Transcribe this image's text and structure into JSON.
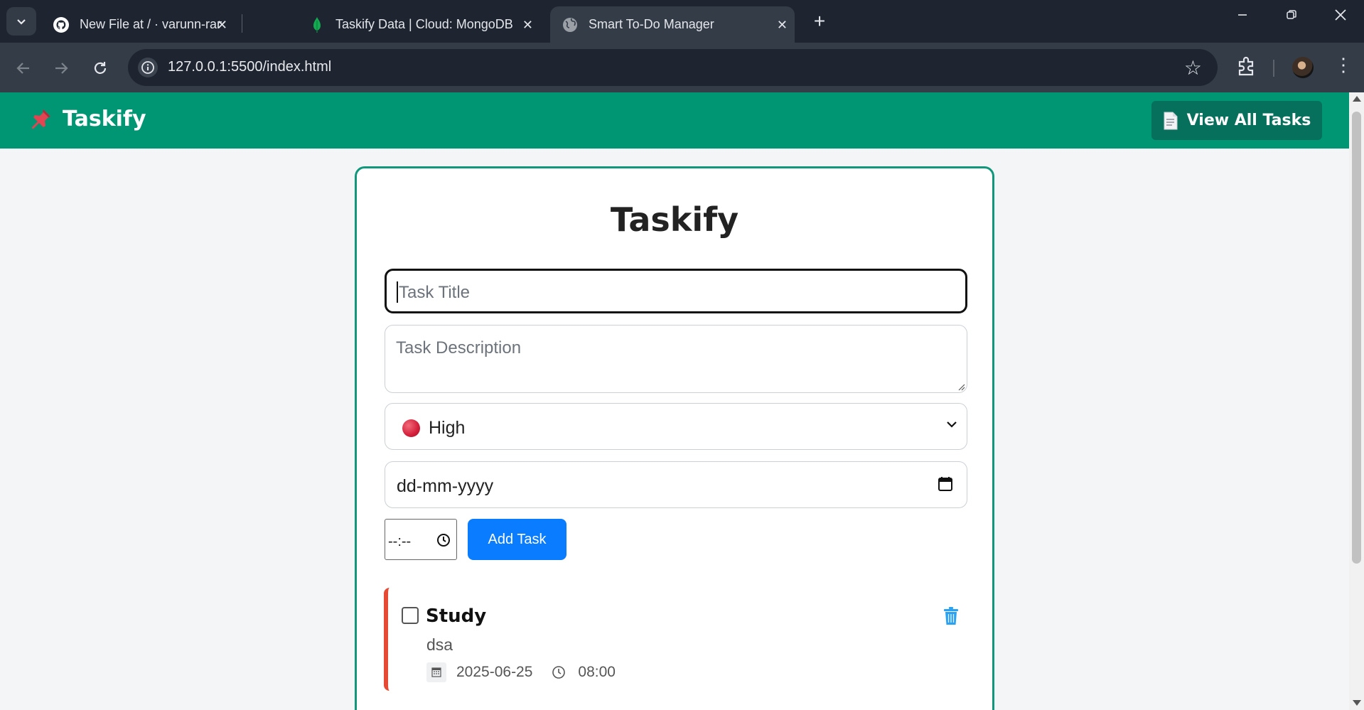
{
  "browser": {
    "tabs": [
      {
        "title": "New File at / · varunn-ranaa/Taskify",
        "icon": "github-icon"
      },
      {
        "title": "Taskify Data | Cloud: MongoDB Cloud",
        "icon": "mongodb-leaf-icon"
      },
      {
        "title": "Smart To-Do Manager",
        "icon": "globe-icon",
        "active": true
      }
    ],
    "url": "127.0.0.1:5500/index.html"
  },
  "navbar": {
    "brand": "Taskify",
    "brand_icon": "pushpin-icon",
    "view_all_label": "View All Tasks",
    "view_all_icon": "document-icon",
    "color": "#009673"
  },
  "form": {
    "title": "Taskify",
    "title_placeholder": "Task Title",
    "description_placeholder": "Task Description",
    "priority": "High",
    "priority_color": "#d31e3a",
    "date_placeholder": "dd-mm-yyyy",
    "time_placeholder": "--:--",
    "add_button": "Add Task",
    "add_button_color": "#0a7cff"
  },
  "tasks": [
    {
      "title": "Study",
      "description": "dsa",
      "date": "2025-06-25",
      "time": "08:00",
      "priority_color": "#e64a35",
      "done": false
    }
  ]
}
